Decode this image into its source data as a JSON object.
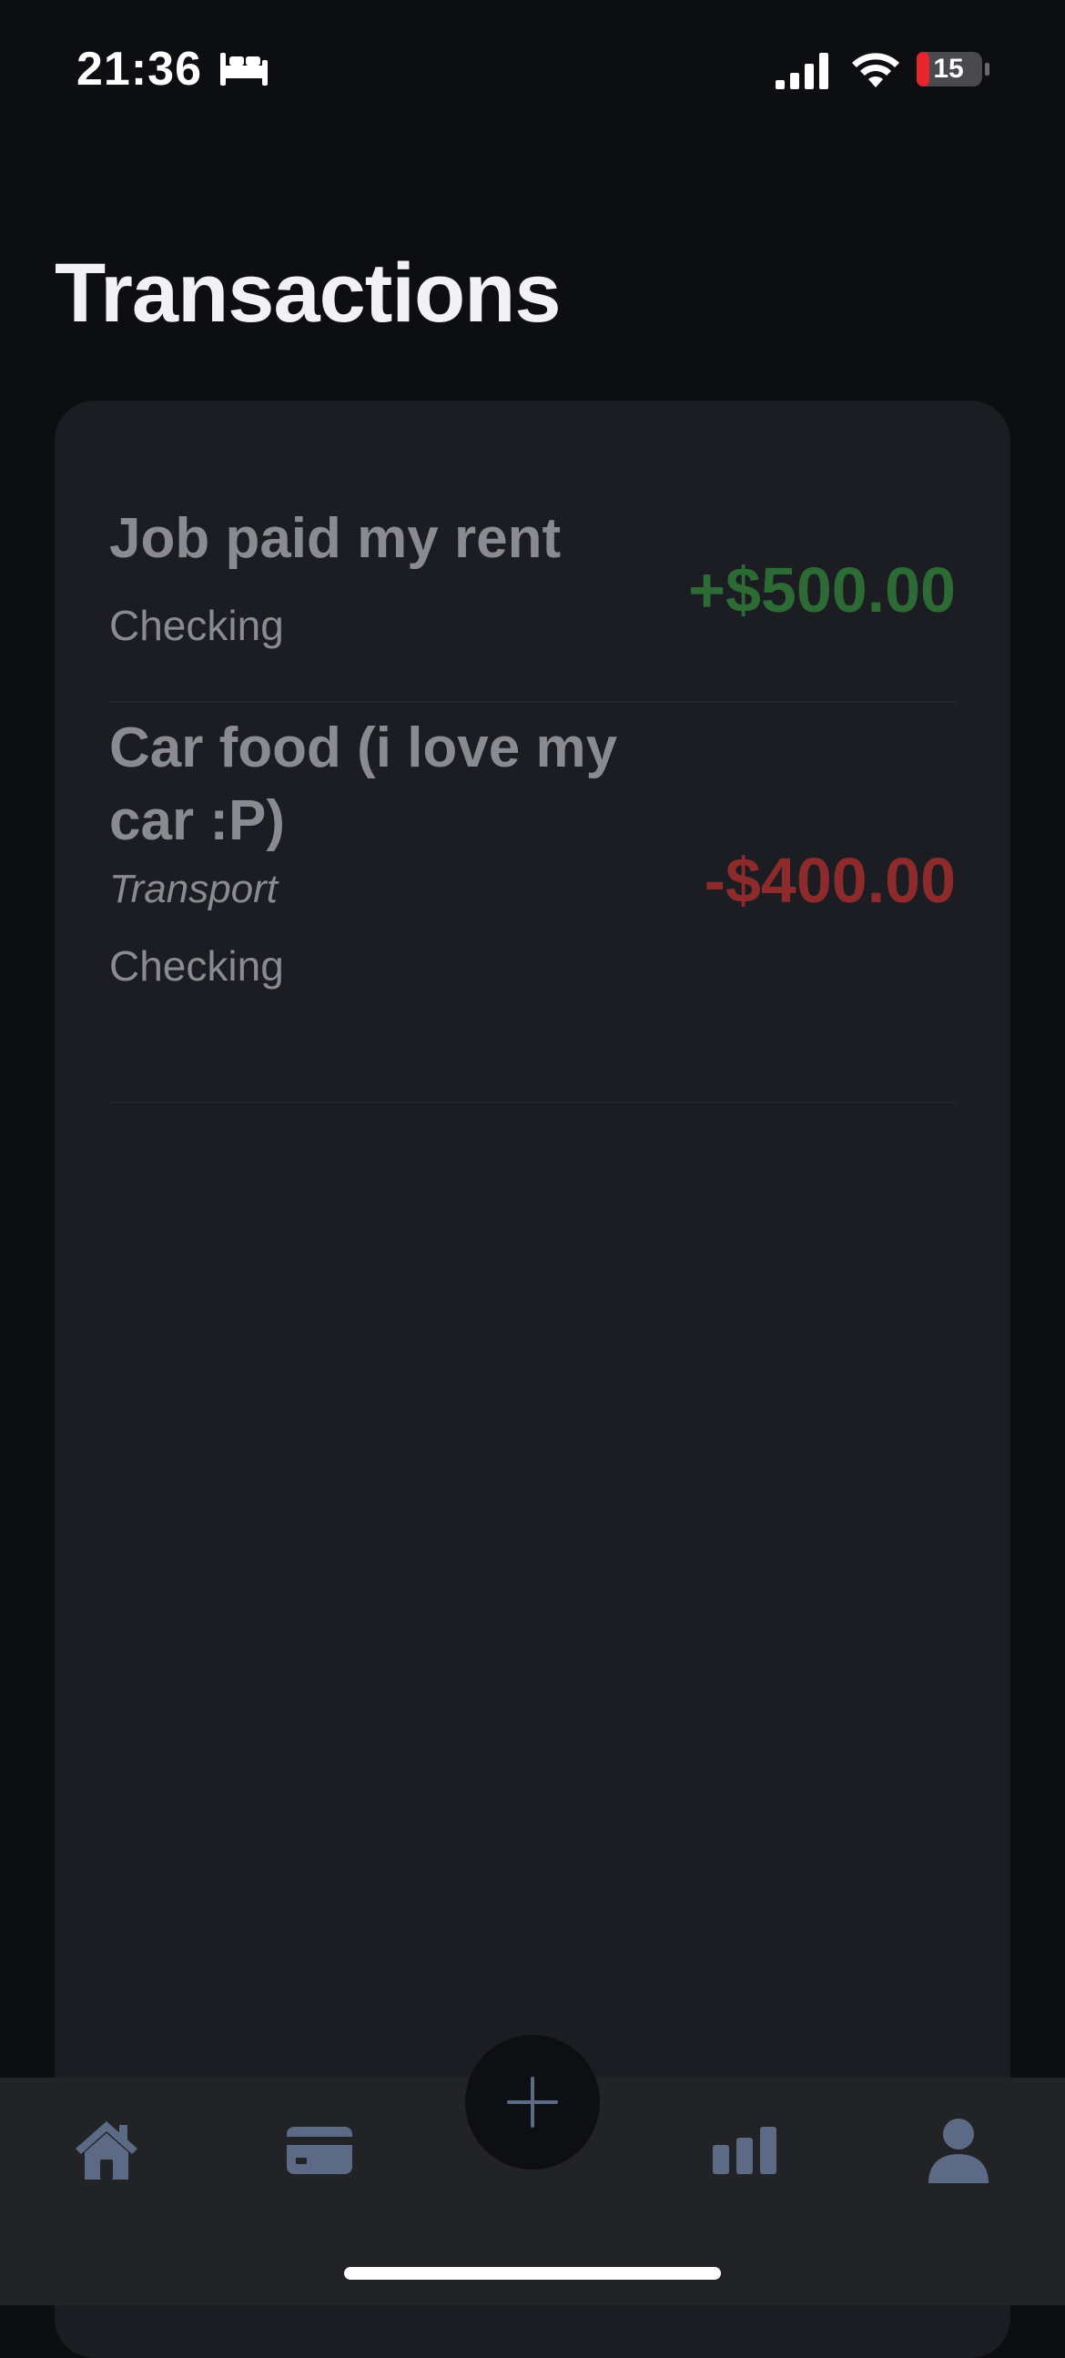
{
  "status_bar": {
    "time": "21:36",
    "battery_level": "15",
    "icons": [
      "sleep-focus-icon",
      "cellular-signal-icon",
      "wifi-icon",
      "battery-charging-icon"
    ]
  },
  "page": {
    "title": "Transactions"
  },
  "transactions": [
    {
      "title": "Job paid my rent",
      "category": "",
      "account": "Checking",
      "amount": "+$500.00",
      "type": "income"
    },
    {
      "title": "Car food (i love my car :P)",
      "category": "Transport",
      "account": "Checking",
      "amount": "-$400.00",
      "type": "expense"
    }
  ],
  "tab_bar": {
    "tabs": [
      {
        "icon": "home-icon"
      },
      {
        "icon": "credit-card-icon"
      },
      {
        "icon": "plus-icon"
      },
      {
        "icon": "bar-chart-icon"
      },
      {
        "icon": "person-icon"
      }
    ]
  },
  "colors": {
    "background": "#0d0e12",
    "card": "#1b1d23",
    "income": "#2d6b35",
    "expense": "#8d2a2b",
    "tab_icon": "#5c6a85",
    "tab_bar": "#222327"
  }
}
